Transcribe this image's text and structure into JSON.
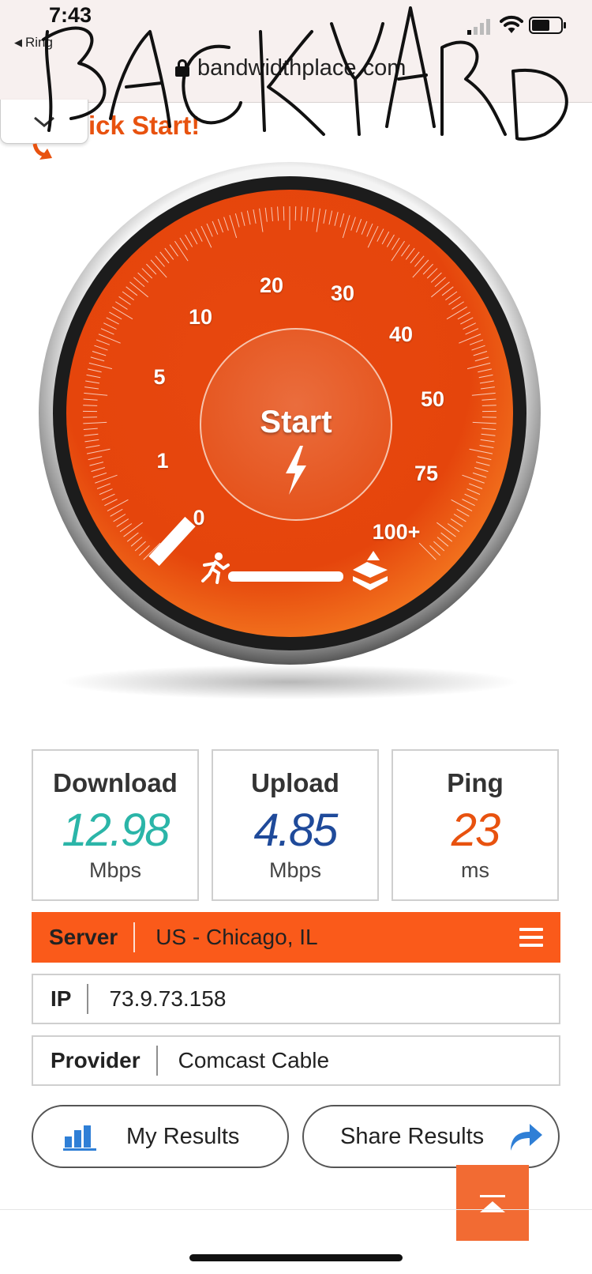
{
  "status_bar": {
    "time": "7:43",
    "back_app": "Ring"
  },
  "browser": {
    "url": "bandwidthplace.com"
  },
  "handwriting": "BACKYARD",
  "quick_start": {
    "label": "ick Start!"
  },
  "gauge": {
    "start_label": "Start",
    "scale_labels": [
      "0",
      "1",
      "5",
      "10",
      "20",
      "30",
      "40",
      "50",
      "75",
      "100+"
    ],
    "accent_color": "#ef4d10"
  },
  "stats": {
    "download": {
      "label": "Download",
      "value": "12.98",
      "unit": "Mbps",
      "color": "#2bb5a8"
    },
    "upload": {
      "label": "Upload",
      "value": "4.85",
      "unit": "Mbps",
      "color": "#1f4a9a"
    },
    "ping": {
      "label": "Ping",
      "value": "23",
      "unit": "ms",
      "color": "#e8520f"
    }
  },
  "info": {
    "server_label": "Server",
    "server_value": "US - Chicago, IL",
    "ip_label": "IP",
    "ip_value": "73.9.73.158",
    "provider_label": "Provider",
    "provider_value": "Comcast Cable"
  },
  "buttons": {
    "my_results": "My Results",
    "share_results": "Share Results"
  },
  "icons": {
    "menu": "hamburger-menu-icon",
    "results": "bar-chart-icon",
    "share": "share-arrow-icon",
    "scroll_top": "scroll-to-top-icon"
  }
}
